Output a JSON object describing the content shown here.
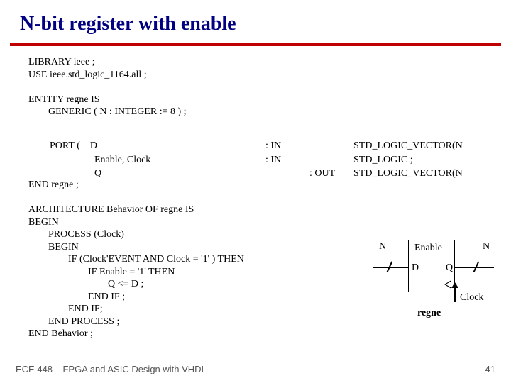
{
  "title": "N-bit register with enable",
  "code_block1": "LIBRARY ieee ;\nUSE ieee.std_logic_1164.all ;\n\nENTITY regne IS\n        GENERIC ( N : INTEGER := 8 ) ;",
  "ports": {
    "row1": {
      "c1": "        PORT (    D",
      "c2": ": IN",
      "c3": "",
      "c4": "STD_LOGIC_VECTOR(N"
    },
    "row2": {
      "c1": "                          Enable, Clock",
      "c2": ": IN",
      "c3": "",
      "c4": "STD_LOGIC ;"
    },
    "row3": {
      "c1": "                          Q",
      "c2": "",
      "c3": ": OUT",
      "c4": "STD_LOGIC_VECTOR(N"
    }
  },
  "code_block2": "END regne ;\n\nARCHITECTURE Behavior OF regne IS\nBEGIN\n        PROCESS (Clock)\n        BEGIN\n                IF (Clock'EVENT AND Clock = '1' ) THEN\n                        IF Enable = '1' THEN\n                                Q <= D ;\n                        END IF ;\n                END IF;\n        END PROCESS ;\nEND Behavior ;",
  "diagram": {
    "N_left": "N",
    "N_right": "N",
    "Enable": "Enable",
    "D": "D",
    "Q": "Q",
    "Clock": "Clock",
    "name": "regne"
  },
  "footer": {
    "left": "ECE 448 – FPGA and ASIC Design with VHDL",
    "right": "41"
  }
}
